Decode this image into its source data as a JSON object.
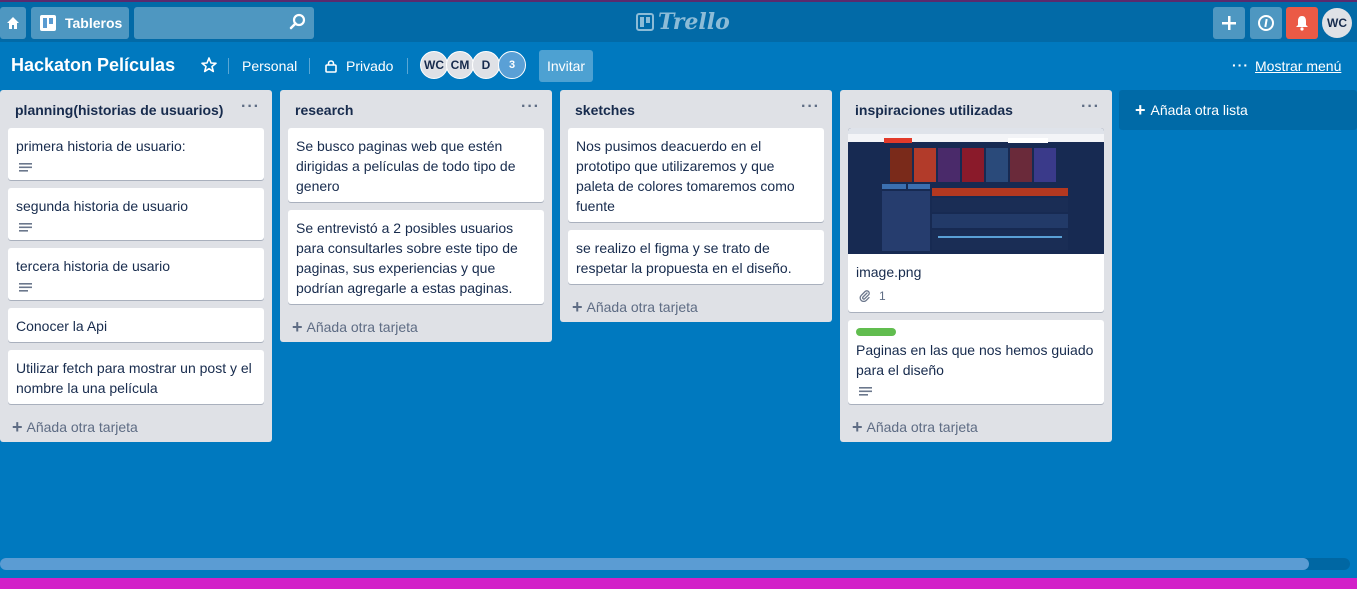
{
  "topbar": {
    "boards_label": "Tableros",
    "search_placeholder": "",
    "logo_text": "Trello",
    "user_initials": "WC"
  },
  "board": {
    "title": "Hackaton Películas",
    "team": "Personal",
    "visibility": "Privado",
    "members": [
      "WC",
      "CM",
      "D"
    ],
    "member_overflow": "3",
    "invite_label": "Invitar",
    "menu_dots": "···",
    "menu_label": "Mostrar menú"
  },
  "lists": [
    {
      "title": "planning(historias de usuarios)",
      "cards": [
        {
          "text": "primera historia de usuario:",
          "has_description": true
        },
        {
          "text": "segunda historia de usuario",
          "has_description": true
        },
        {
          "text": "tercera historia de usario",
          "has_description": true
        },
        {
          "text": "Conocer la Api",
          "has_description": false
        },
        {
          "text": "Utilizar fetch para mostrar un post y el nombre la una película",
          "has_description": false
        }
      ],
      "add_card": "Añada otra tarjeta"
    },
    {
      "title": "research",
      "cards": [
        {
          "text": "Se busco paginas web que estén dirigidas a películas de todo tipo de genero",
          "has_description": false
        },
        {
          "text": "Se entrevistó a 2 posibles usuarios para consultarles sobre este tipo de paginas, sus experiencias y que podrían agregarle a estas paginas.",
          "has_description": false
        }
      ],
      "add_card": "Añada otra tarjeta"
    },
    {
      "title": "sketches",
      "cards": [
        {
          "text": "Nos pusimos deacuerdo en el prototipo que utilizaremos y que paleta de colores tomaremos como fuente",
          "has_description": false
        },
        {
          "text": "se realizo el figma y se trato de respetar la propuesta en el diseño.",
          "has_description": false
        }
      ],
      "add_card": "Añada otra tarjeta"
    },
    {
      "title": "inspiraciones utilizadas",
      "cards": [
        {
          "text": "image.png",
          "attachments": "1",
          "has_cover": true
        },
        {
          "text": "Paginas en las que nos hemos guiado para el diseño",
          "has_description": true,
          "label_color": "#61bd4f"
        }
      ],
      "add_card": "Añada otra tarjeta"
    }
  ],
  "add_list": "Añada otra lista",
  "colors": {
    "board_bg": "#0079bf",
    "header_bg": "#026aa7",
    "list_bg": "#dfe1e6",
    "notification": "#eb5a46",
    "label_green": "#61bd4f"
  }
}
